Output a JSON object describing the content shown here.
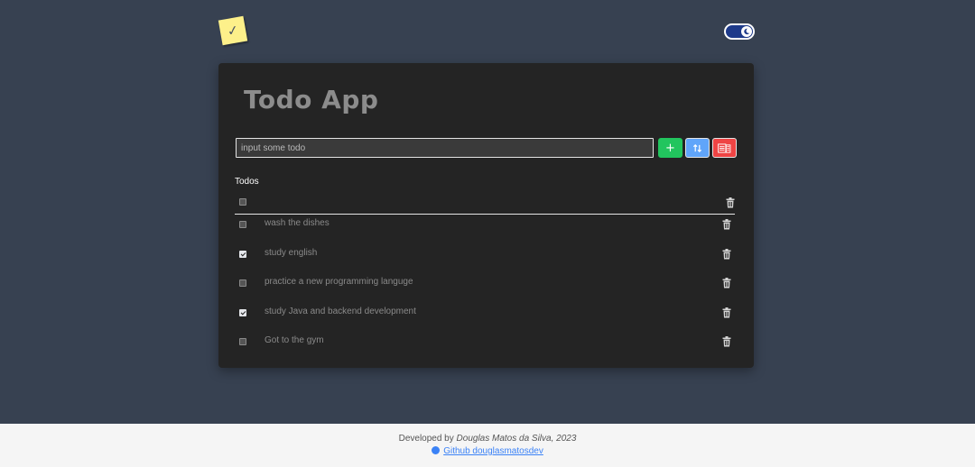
{
  "app": {
    "logo_icon": "sticky-note-check-icon",
    "theme_toggle_icon": "moon-icon",
    "title": "Todo App"
  },
  "input": {
    "placeholder": "input some todo",
    "value": ""
  },
  "toolbar": {
    "add_label": "+",
    "sort_icon": "sort-arrows-icon",
    "clear_icon": "clear-list-icon"
  },
  "todos": {
    "section_label": "Todos",
    "items": [
      {
        "text": "wash the dishes",
        "done": false
      },
      {
        "text": "study english",
        "done": true
      },
      {
        "text": "practice a new programming languge",
        "done": false
      },
      {
        "text": "study Java and backend development",
        "done": true
      },
      {
        "text": "Got to the gym",
        "done": false
      }
    ]
  },
  "footer": {
    "developed_by": "Developed by",
    "author": "Douglas Matos da Silva, 2023",
    "github_link_text": "Github douglasmatosdev",
    "github_icon": "github-icon"
  },
  "colors": {
    "background": "#374151",
    "card": "#242424",
    "add_button": "#22c55e",
    "sort_button": "#60a5fa",
    "clear_button": "#ef4444",
    "toggle": "#1e3a8a"
  }
}
